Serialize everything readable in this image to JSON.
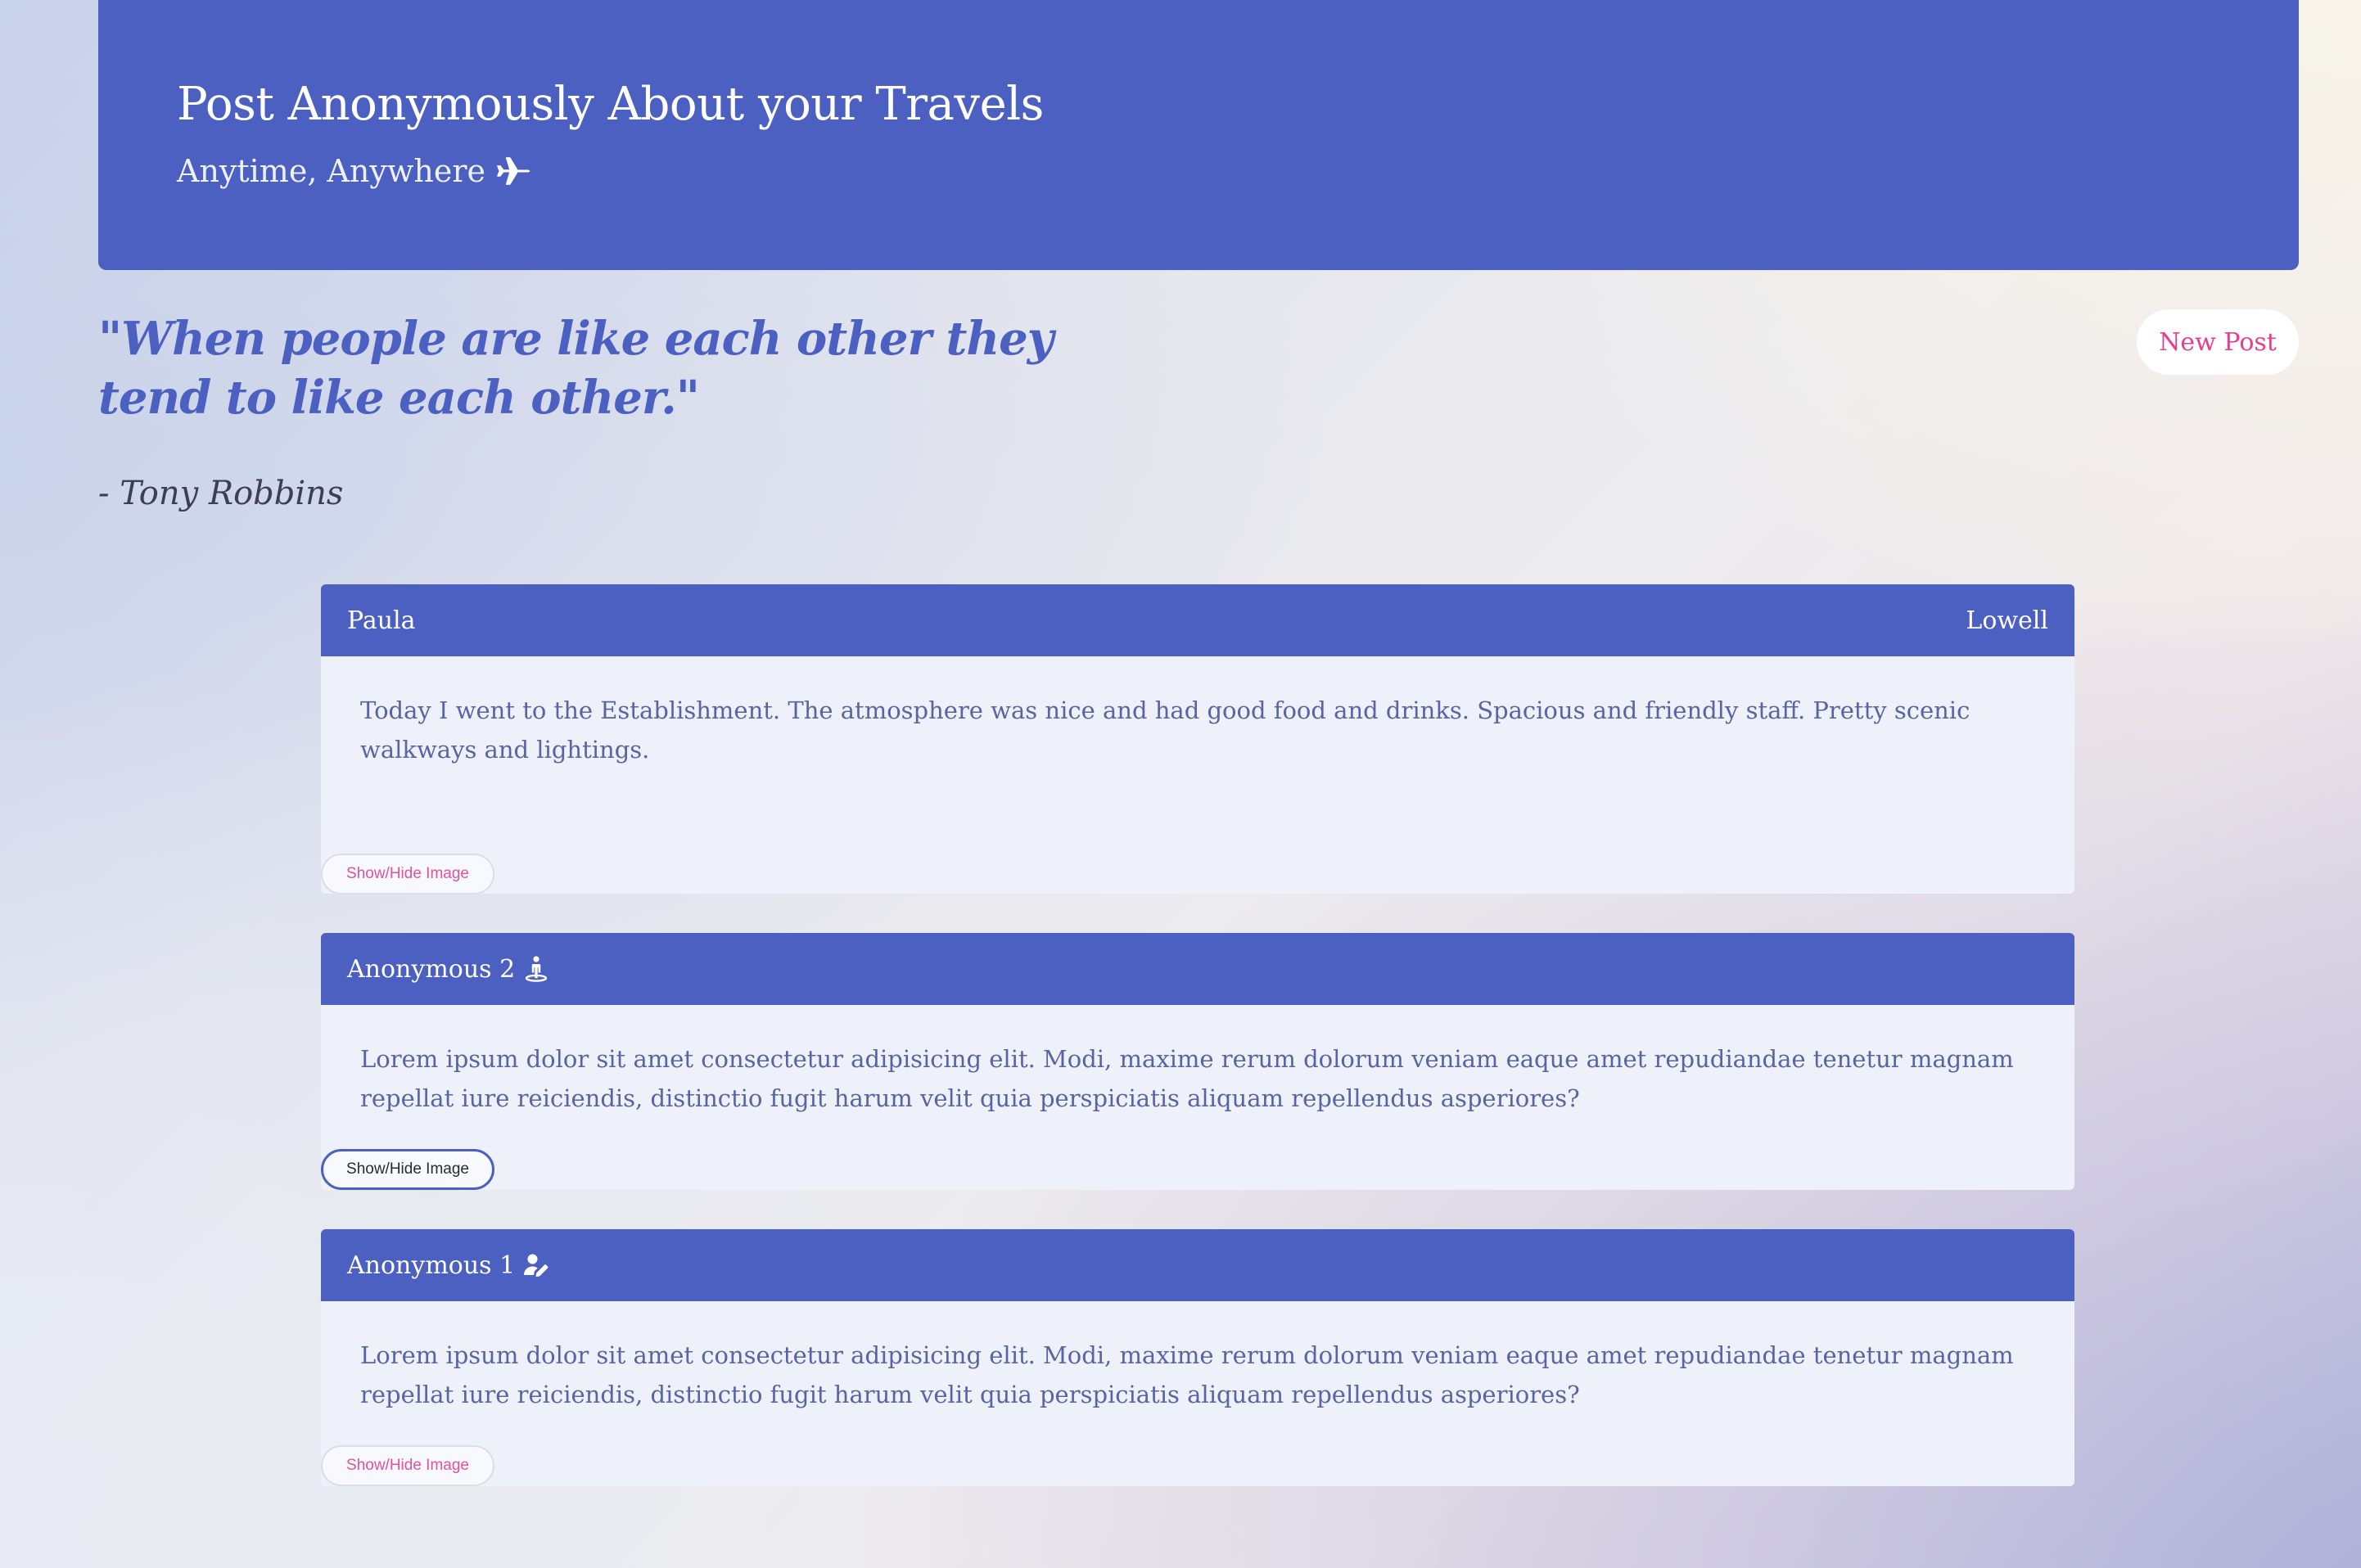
{
  "hero": {
    "title": "Post Anonymously About your Travels",
    "subtitle": "Anytime, Anywhere",
    "subtitle_icon": "airplane-icon"
  },
  "quote": {
    "text": "\"When people are like each other they tend to like each other.\"",
    "author": "- Tony Robbins"
  },
  "new_post_label": "New Post",
  "colors": {
    "primary": "#4b60c1",
    "accent": "#e83e8c",
    "card_bg": "#eef1f9"
  },
  "posts": [
    {
      "name": "Paula",
      "location": "Lowell",
      "icon": "",
      "body": "Today I went to the Establishment. The atmosphere was nice and had good food and drinks. Spacious and friendly staff. Pretty scenic walkways and lightings.",
      "toggle_label": "Show/Hide Image"
    },
    {
      "name": "Anonymous 2",
      "location": "",
      "icon": "person-hiking-icon",
      "body": "Lorem ipsum dolor sit amet consectetur adipisicing elit. Modi, maxime rerum dolorum veniam eaque amet repudiandae tenetur magnam repellat iure reiciendis, distinctio fugit harum velit quia perspiciatis aliquam repellendus asperiores?",
      "toggle_label": "Show/Hide Image"
    },
    {
      "name": "Anonymous 1",
      "location": "",
      "icon": "user-pen-icon",
      "body": "Lorem ipsum dolor sit amet consectetur adipisicing elit. Modi, maxime rerum dolorum veniam eaque amet repudiandae tenetur magnam repellat iure reiciendis, distinctio fugit harum velit quia perspiciatis aliquam repellendus asperiores?",
      "toggle_label": "Show/Hide Image"
    }
  ]
}
